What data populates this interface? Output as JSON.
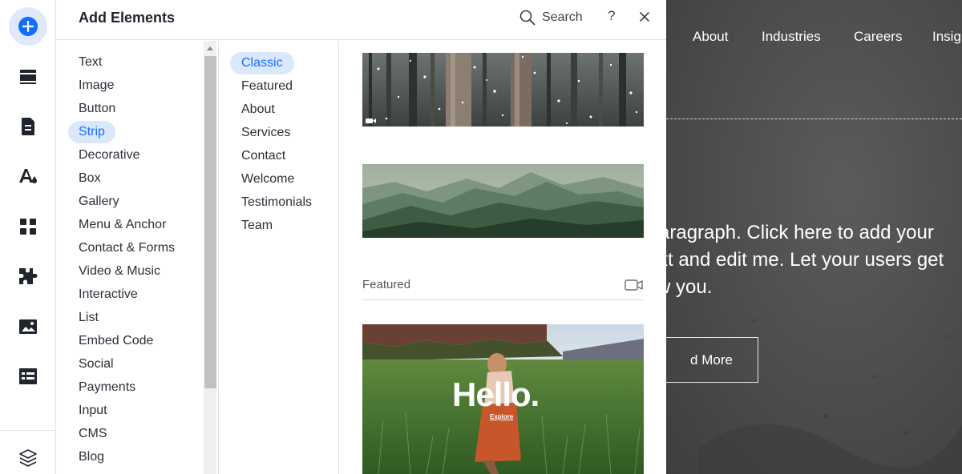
{
  "toolbar": {
    "items": [
      {
        "icon": "plus-icon"
      },
      {
        "icon": "section-icon"
      },
      {
        "icon": "page-icon"
      },
      {
        "icon": "design-icon"
      },
      {
        "icon": "apps-grid-icon"
      },
      {
        "icon": "puzzle-icon"
      },
      {
        "icon": "media-icon"
      },
      {
        "icon": "cms-table-icon"
      },
      {
        "icon": "layers-icon"
      }
    ]
  },
  "panel": {
    "title": "Add Elements",
    "search_label": "Search",
    "help_label": "?",
    "categories": [
      "Text",
      "Image",
      "Button",
      "Strip",
      "Decorative",
      "Box",
      "Gallery",
      "Menu & Anchor",
      "Contact & Forms",
      "Video & Music",
      "Interactive",
      "List",
      "Embed Code",
      "Social",
      "Payments",
      "Input",
      "CMS",
      "Blog"
    ],
    "selected_category": "Strip",
    "subcategories": [
      "Classic",
      "Featured",
      "About",
      "Services",
      "Contact",
      "Welcome",
      "Testimonials",
      "Team"
    ],
    "selected_subcategory": "Classic",
    "featured_label": "Featured",
    "hello_text": "Hello.",
    "explore_text": "Explore"
  },
  "site": {
    "nav": [
      "About",
      "Industries",
      "Careers",
      "Insig"
    ],
    "paragraph_lines": [
      "aragraph. Click here to add your",
      "xt and edit me. Let your users get",
      "w you."
    ],
    "button_label": "d More"
  },
  "colors": {
    "accent": "#116dff",
    "selected_bg": "#dbe8fb"
  }
}
